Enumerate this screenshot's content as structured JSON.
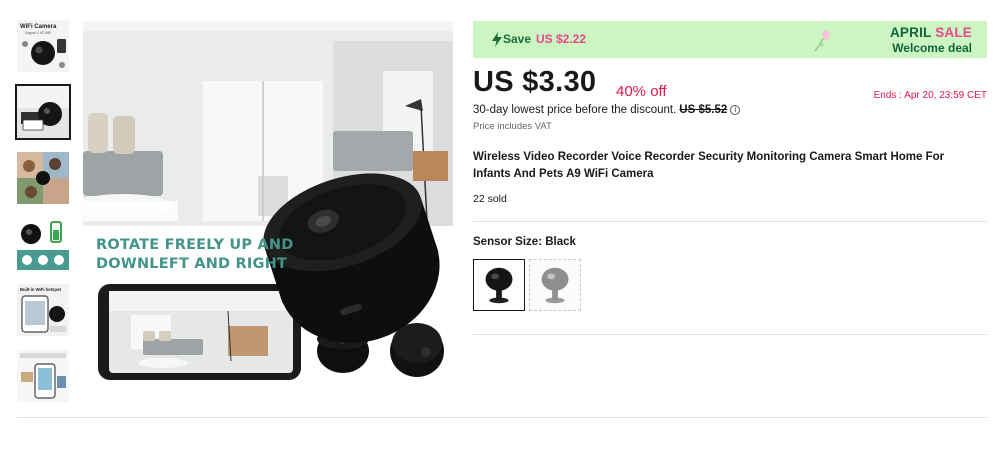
{
  "thumbnails": [
    {
      "name": "thumb-1",
      "caption": "WiFi Camera",
      "caption2": "Support 2.4G WiFi"
    },
    {
      "name": "thumb-2"
    },
    {
      "name": "thumb-3"
    },
    {
      "name": "thumb-4"
    },
    {
      "name": "thumb-5",
      "caption": "Built-in WiFi hotspot"
    },
    {
      "name": "thumb-6"
    }
  ],
  "main_image": {
    "overlay_line1": "ROTATE FREELY UP AND",
    "overlay_line2": "DOWNLEFT AND RIGHT"
  },
  "promo": {
    "save_word": "Save",
    "save_amount": "US $2.22",
    "sale_word1": "APRIL",
    "sale_word2": "SALE",
    "sale_subtitle": "Welcome deal",
    "colors": {
      "background": "#cbf5c1",
      "green": "#14623a",
      "pink": "#e8488b"
    }
  },
  "pricing": {
    "price": "US $3.30",
    "discount": "40% off",
    "ends": "Ends :  Apr 20, 23:59 CET",
    "lowest_text": "30-day lowest price before the discount.",
    "old_price": "US $5.52",
    "info_icon": "i",
    "vat": "Price includes VAT",
    "accent_color": "#e0184c"
  },
  "product": {
    "title": "Wireless Video Recorder Voice Recorder Security Monitoring Camera Smart Home For Infants And Pets A9 WiFi Camera",
    "sold": "22 sold"
  },
  "sku": {
    "label": "Sensor Size: Black",
    "options": [
      {
        "name": "Black",
        "selected": true
      },
      {
        "name": "Gray",
        "selected": false
      }
    ]
  }
}
